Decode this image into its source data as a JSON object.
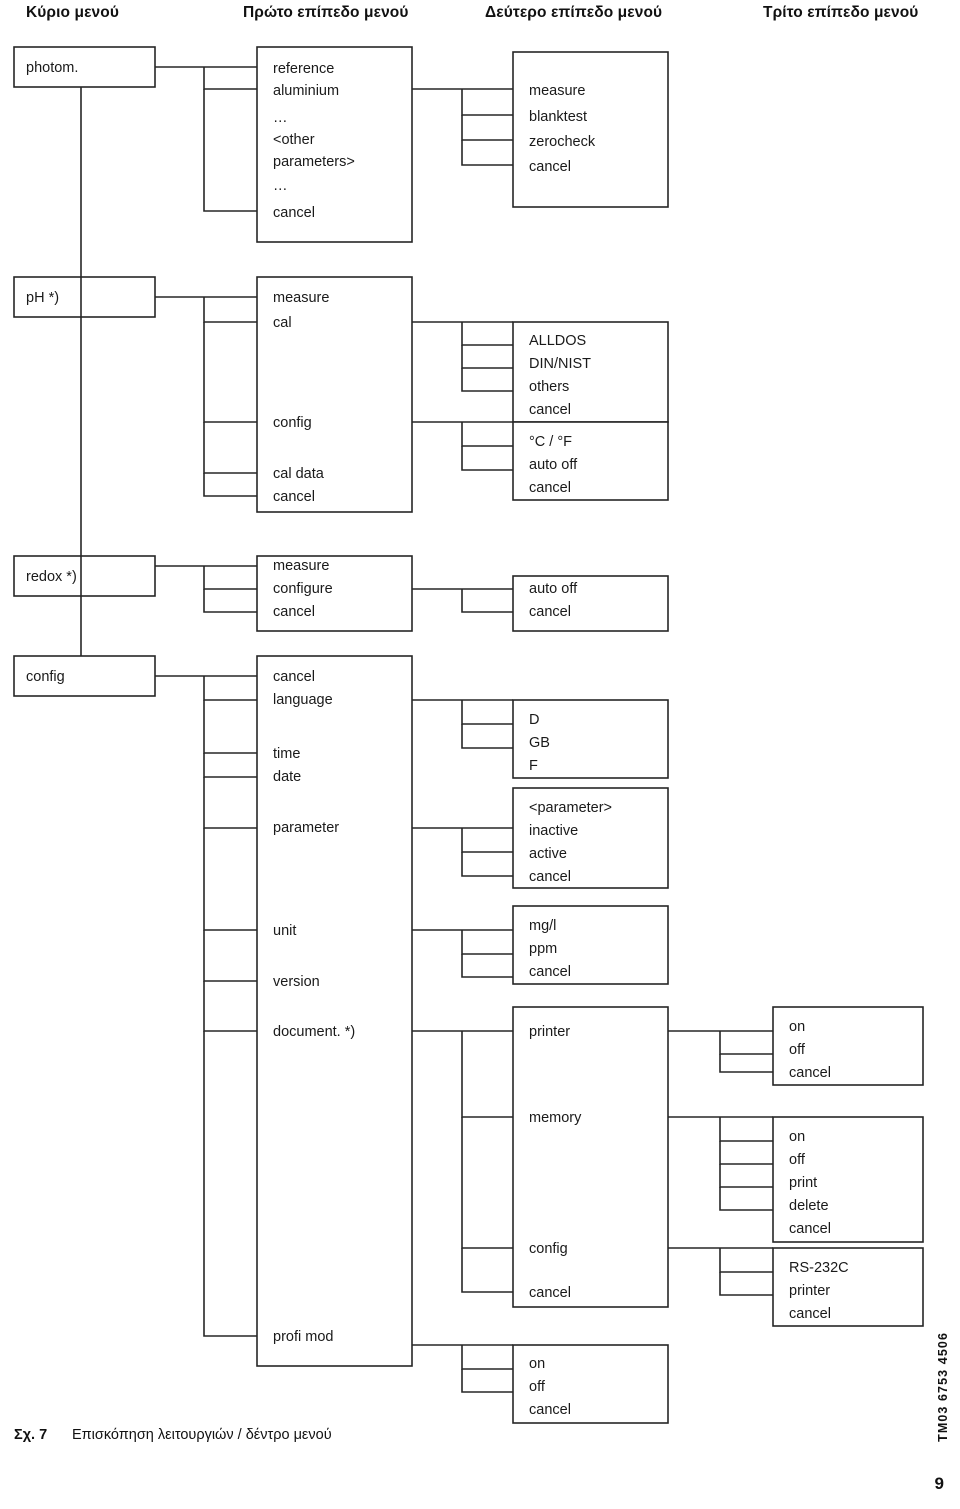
{
  "header": {
    "columns": [
      {
        "label": "Κύριο μενού"
      },
      {
        "label": "Πρώτο επίπεδο μενού"
      },
      {
        "label": "Δεύτερο επίπεδο μενού"
      },
      {
        "label": "Τρίτο επίπεδο μενού"
      }
    ]
  },
  "caption": {
    "figure_number": "Σχ. 7",
    "text": "Επισκόπηση λειτουργιών / δέντρο μενού"
  },
  "footer": {
    "drawing_code": "TM03 6753 4506",
    "page_number": "9"
  },
  "menu_tree": {
    "main": [
      {
        "id": "photom",
        "label": "photom."
      },
      {
        "id": "ph",
        "label": "pH *)"
      },
      {
        "id": "redox",
        "label": "redox *)"
      },
      {
        "id": "config",
        "label": "config"
      }
    ],
    "photom": {
      "level1": [
        "reference",
        "aluminium",
        "…",
        "<other",
        "parameters>",
        "…",
        "cancel"
      ],
      "level2": [
        "measure",
        "blanktest",
        "zerocheck",
        "cancel"
      ]
    },
    "ph": {
      "level1": [
        "measure",
        "cal",
        "config",
        "cal data",
        "cancel"
      ],
      "level2_cal": [
        "ALLDOS",
        "DIN/NIST",
        "others",
        "cancel"
      ],
      "level2_config": [
        "°C / °F",
        "auto off",
        "cancel"
      ]
    },
    "redox": {
      "level1": [
        "measure",
        "configure",
        "cancel"
      ],
      "level2": [
        "auto off",
        "cancel"
      ]
    },
    "config": {
      "level1": [
        "cancel",
        "language",
        "time",
        "date",
        "parameter",
        "unit",
        "version",
        "document. *)",
        "profi mod"
      ],
      "level2_language": [
        "D",
        "GB",
        "F"
      ],
      "level2_parameter": [
        "<parameter>",
        "inactive",
        "active",
        "cancel"
      ],
      "level2_unit": [
        "mg/l",
        "ppm",
        "cancel"
      ],
      "level2_document": [
        "printer",
        "memory",
        "config",
        "cancel"
      ],
      "level2_profimod": [
        "on",
        "off",
        "cancel"
      ],
      "level3_printer": [
        "on",
        "off",
        "cancel"
      ],
      "level3_memory": [
        "on",
        "off",
        "print",
        "delete",
        "cancel"
      ],
      "level3_config": [
        "RS-232C",
        "printer",
        "cancel"
      ]
    }
  },
  "colors": {
    "stroke": "#262626",
    "text": "#1a1a1a",
    "background": "#ffffff"
  }
}
